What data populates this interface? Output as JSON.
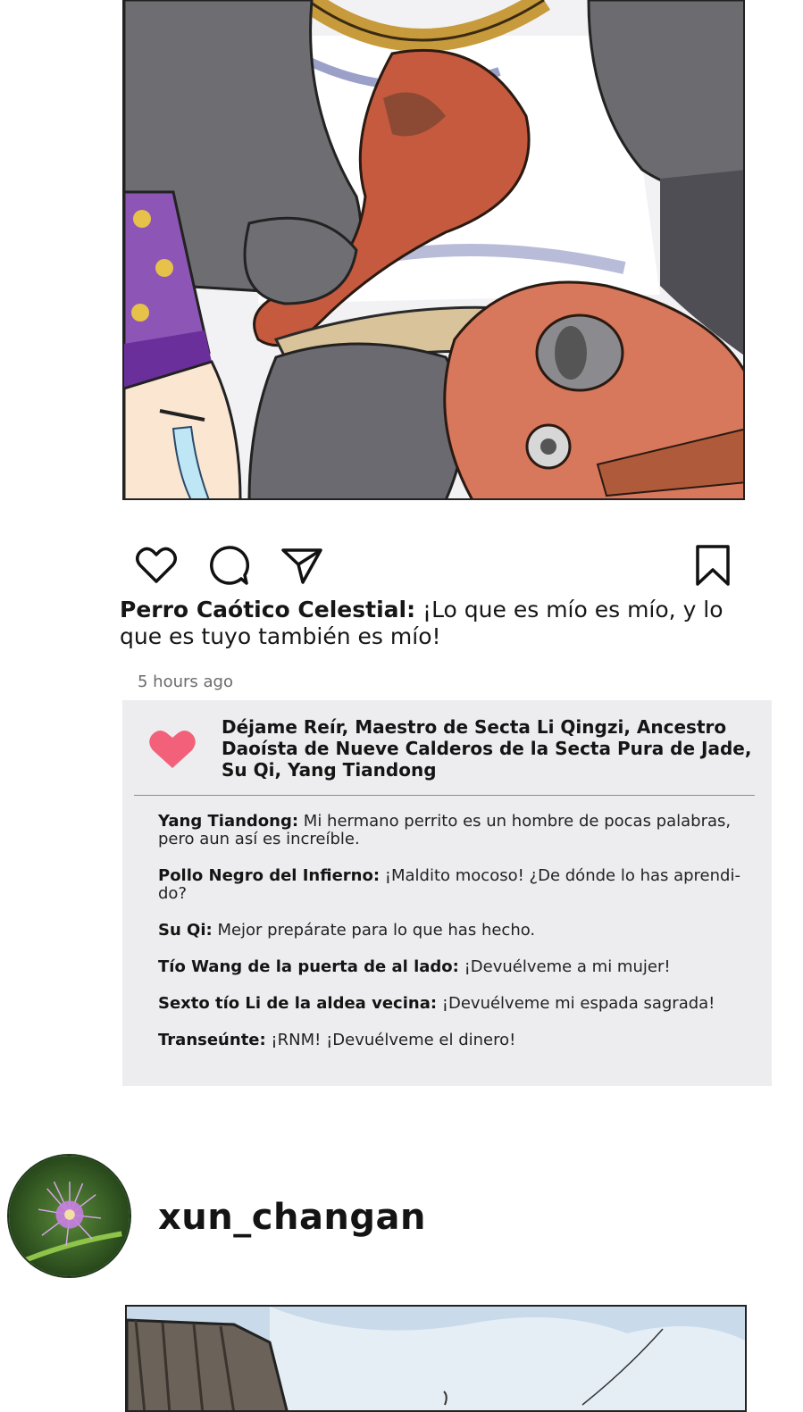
{
  "post": {
    "caption": {
      "author": "Perro Caótico Celestial:",
      "text": " ¡Lo que es mío es mío, y lo que es tuyo también es mío!"
    },
    "timestamp": "5 hours ago",
    "likes": {
      "names": "Déjame Reír, Maestro de Secta Li Qingzi, Ancestro Daoísta de Nueve Calderos de la Secta Pura de Jade, Su Qi, Yang Tiandong"
    },
    "comments": [
      {
        "author": "Yang Tiandong:",
        "text": " Mi hermano perrito es un hombre de pocas palabras, pero aun así es increíble."
      },
      {
        "author": "Pollo Negro del Infierno:",
        "text": " ¡Maldito mocoso! ¿De dónde lo has aprendi-do?"
      },
      {
        "author": "Su Qi:",
        "text": " Mejor prepárate para lo que has hecho."
      },
      {
        "author": "Tío Wang de la puerta de al lado:",
        "text": " ¡Devuélveme a mi mujer!"
      },
      {
        "author": "Sexto tío Li de la aldea vecina:",
        "text": " ¡Devuélveme mi espada sagrada!"
      },
      {
        "author": "Transeúnte:",
        "text": " ¡RNM! ¡Devuélveme el dinero!"
      }
    ]
  },
  "icons": {
    "like": "heart-outline-icon",
    "comment": "speech-bubble-icon",
    "share": "paper-plane-icon",
    "save": "bookmark-icon",
    "likes_heart": "filled-heart-icon"
  },
  "colors": {
    "card_background": "#ededef",
    "likes_heart": "#f2607a",
    "timestamp": "#6b6b6b"
  },
  "next_post": {
    "username": "xun_changan"
  }
}
